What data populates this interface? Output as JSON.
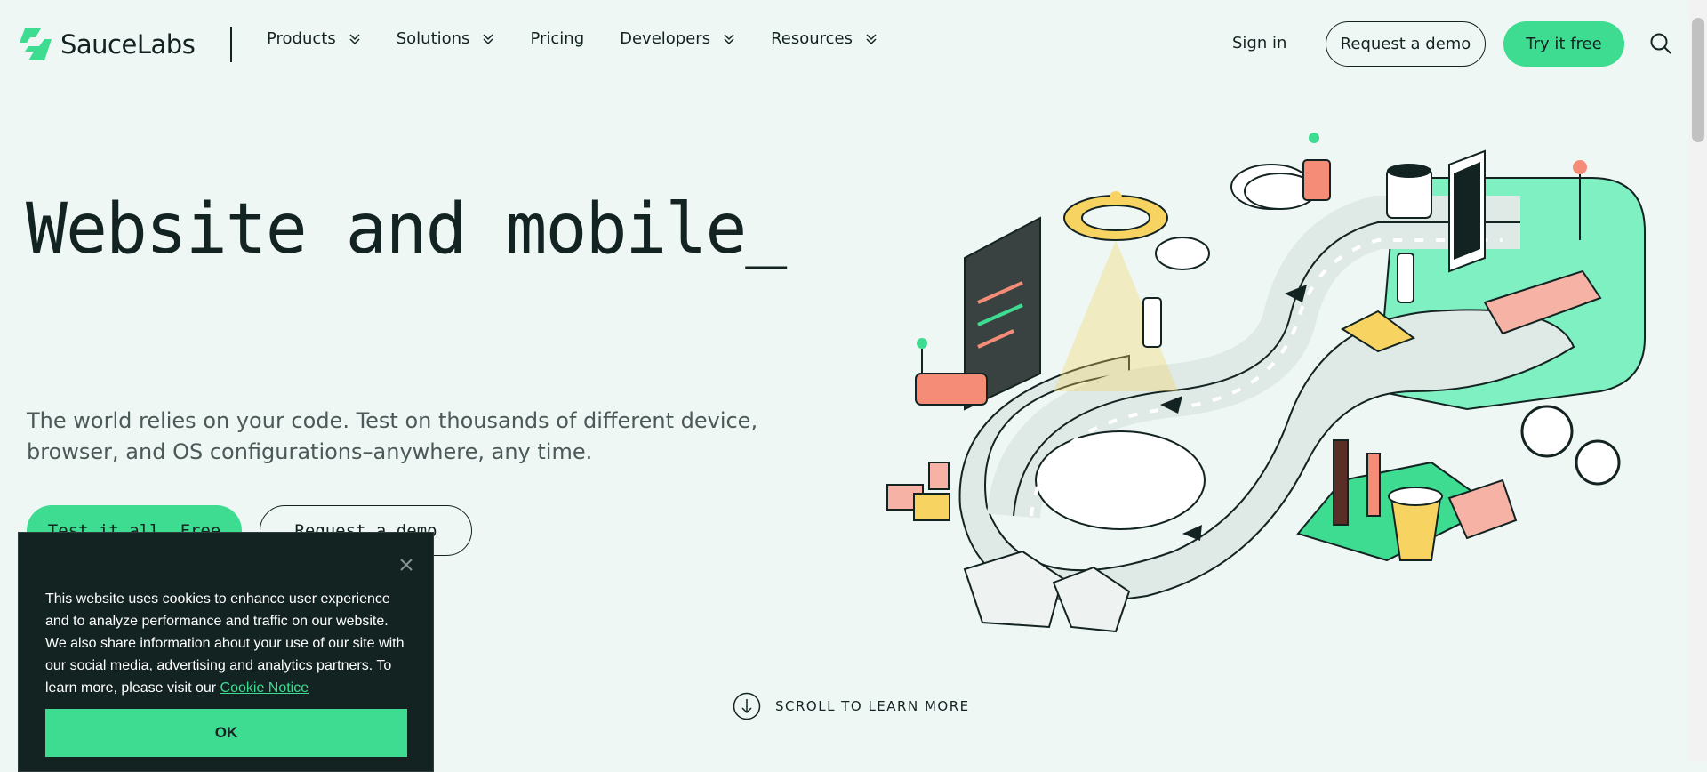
{
  "brand": {
    "name_bold": "Sauce",
    "name_light": "Labs",
    "accent": "#3ddc91",
    "dark": "#132322",
    "background": "#eef7f4"
  },
  "nav": {
    "items": [
      {
        "label": "Products",
        "has_dropdown": true
      },
      {
        "label": "Solutions",
        "has_dropdown": true
      },
      {
        "label": "Pricing",
        "has_dropdown": false
      },
      {
        "label": "Developers",
        "has_dropdown": true
      },
      {
        "label": "Resources",
        "has_dropdown": true
      }
    ],
    "sign_in": "Sign in",
    "request_demo": "Request a demo",
    "try_free": "Try it free",
    "search_icon": "search-icon"
  },
  "hero": {
    "title": "Website and mobile_",
    "subtitle": "The world relies on your code. Test on thousands of different device, browser, and OS configurations–anywhere, any time.",
    "primary_cta": "Test it all. Free",
    "secondary_cta": "Request a demo"
  },
  "scroll_cta": {
    "label": "SCROLL TO LEARN MORE",
    "icon": "arrow-down-circle-icon"
  },
  "illustration": {
    "icon": "infinity-testing-illustration"
  },
  "cookie_banner": {
    "text": "This website uses cookies to enhance user experience and to analyze performance and traffic on our website. We also share information about your use of our site with our social media, advertising and analytics partners. To learn more, please visit our ",
    "link": "Cookie Notice",
    "ok": "OK",
    "close_icon": "close-icon"
  }
}
